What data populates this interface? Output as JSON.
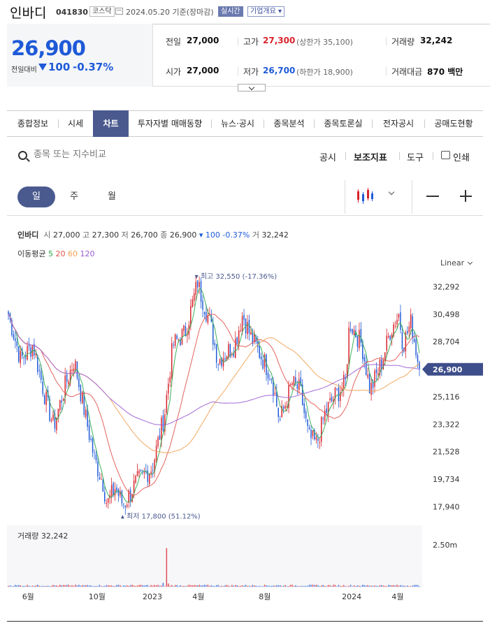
{
  "header": {
    "stock_name": "인바디",
    "stock_code": "041830",
    "market": "코스닥",
    "date_text": "2024.05.20 기준(장마감)",
    "realtime": "실시간",
    "company_info": "기업개요"
  },
  "quote": {
    "current_price": "26,900",
    "change_label": "전일대비",
    "change_value": "100",
    "change_pct": "-0.37%",
    "prev_label": "전일",
    "prev": "27,000",
    "high_label": "고가",
    "high": "27,300",
    "upper_limit": "(상한가 35,100)",
    "volume_label": "거래량",
    "volume": "32,242",
    "open_label": "시가",
    "open": "27,000",
    "low_label": "저가",
    "low": "26,700",
    "lower_limit": "(하한가 18,900)",
    "amount_label": "거래대금",
    "amount": "870 백만"
  },
  "tabs": [
    "종합정보",
    "시세",
    "차트",
    "투자자별 매매동향",
    "뉴스·공시",
    "종목분석",
    "종목토론실",
    "전자공시",
    "공매도현황"
  ],
  "toolbar": {
    "search_placeholder": "종목 또는 지수비교",
    "disclosure": "공시",
    "indicators": "보조지표",
    "tools": "도구",
    "print": "인쇄"
  },
  "period": {
    "day": "일",
    "week": "주",
    "month": "월"
  },
  "legend": {
    "name": "인바디",
    "open_label": "시",
    "open": "27,000",
    "high_label": "고",
    "high": "27,300",
    "low_label": "저",
    "low": "26,700",
    "close_label": "종",
    "close": "26,900",
    "change": "▾ 100 -0.37%",
    "vol_label": "거",
    "volume": "32,242",
    "ma_label": "이동평균",
    "ma5": "5",
    "ma20": "20",
    "ma60": "60",
    "ma120": "120"
  },
  "scale": "Linear",
  "colors": {
    "up": "#d8232a",
    "down": "#1e5ad8",
    "ma5": "#2aa84a",
    "ma20": "#e0534d",
    "ma60": "#f0a050",
    "ma120": "#9a5ad0",
    "accent": "#4a5a8f"
  },
  "chart_data": {
    "type": "candlestick",
    "y_ticks": [
      "32,292",
      "30,498",
      "28,704",
      "26,910",
      "25,116",
      "23,322",
      "21,528",
      "19,734",
      "17,940"
    ],
    "x_labels": [
      "6월",
      "10월",
      "2023",
      "4월",
      "8월",
      "2024",
      "4월"
    ],
    "last_price_label": "26,900",
    "max_label": "▾ 최고 32,550 (-17.36%)",
    "min_label": "▴ 최저 17,800 (51.12%)",
    "ylim": [
      17500,
      33000
    ],
    "max": 32550,
    "min": 17800,
    "last": 26900,
    "close_anchors": [
      [
        0,
        30500
      ],
      [
        0.03,
        27500
      ],
      [
        0.06,
        28500
      ],
      [
        0.09,
        25000
      ],
      [
        0.11,
        23200
      ],
      [
        0.14,
        26000
      ],
      [
        0.16,
        27500
      ],
      [
        0.19,
        23500
      ],
      [
        0.21,
        21000
      ],
      [
        0.23,
        19500
      ],
      [
        0.24,
        18100
      ],
      [
        0.26,
        19200
      ],
      [
        0.28,
        18000
      ],
      [
        0.31,
        19500
      ],
      [
        0.35,
        20500
      ],
      [
        0.38,
        24000
      ],
      [
        0.4,
        28500
      ],
      [
        0.43,
        29300
      ],
      [
        0.46,
        32500
      ],
      [
        0.49,
        30000
      ],
      [
        0.51,
        27500
      ],
      [
        0.55,
        28500
      ],
      [
        0.57,
        30500
      ],
      [
        0.59,
        29000
      ],
      [
        0.62,
        27500
      ],
      [
        0.64,
        26500
      ],
      [
        0.66,
        23500
      ],
      [
        0.69,
        26000
      ],
      [
        0.71,
        25500
      ],
      [
        0.73,
        22500
      ],
      [
        0.75,
        22000
      ],
      [
        0.77,
        24000
      ],
      [
        0.79,
        25000
      ],
      [
        0.82,
        26000
      ],
      [
        0.83,
        30000
      ],
      [
        0.86,
        28500
      ],
      [
        0.88,
        25500
      ],
      [
        0.91,
        27500
      ],
      [
        0.93,
        29500
      ],
      [
        0.95,
        30500
      ],
      [
        0.96,
        28500
      ],
      [
        0.98,
        30000
      ],
      [
        1.0,
        26900
      ]
    ],
    "volume": {
      "label": "거래량",
      "value": "32,242",
      "axis_label": "2.50m",
      "spike_pos": 0.385,
      "spike_value": 2300000,
      "ylim": [
        0,
        2500000
      ]
    }
  }
}
